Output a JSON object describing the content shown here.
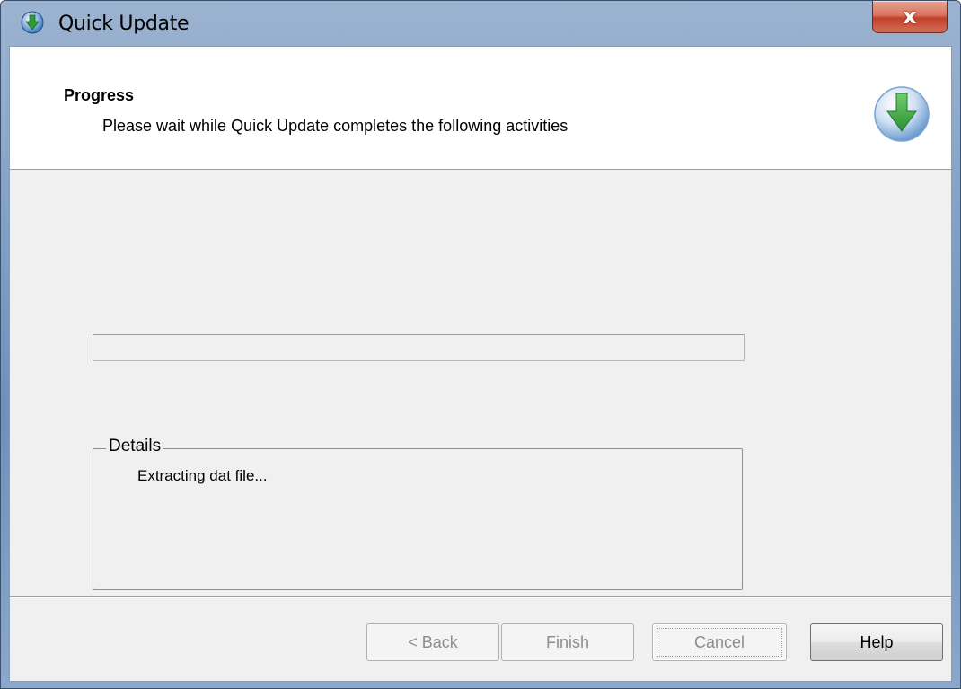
{
  "window": {
    "title": "Quick Update",
    "icon": "download-arrow-icon",
    "close_label": "x"
  },
  "header": {
    "title": "Progress",
    "subtitle": "Please wait while Quick Update completes the following activities",
    "icon": "download-arrow-icon"
  },
  "progress": {
    "value": 0
  },
  "details": {
    "legend": "Details",
    "text": "Extracting dat file..."
  },
  "buttons": {
    "back": {
      "prefix": "< ",
      "mnemonic": "B",
      "rest": "ack",
      "enabled": false
    },
    "finish": {
      "label": "Finish",
      "enabled": false
    },
    "cancel": {
      "mnemonic": "C",
      "rest": "ancel",
      "enabled": false
    },
    "help": {
      "mnemonic": "H",
      "rest": "elp",
      "enabled": true
    }
  },
  "colors": {
    "progress_fill": "#06b025",
    "icon_green": "#3aa64a",
    "icon_blue": "#3c78c2"
  }
}
